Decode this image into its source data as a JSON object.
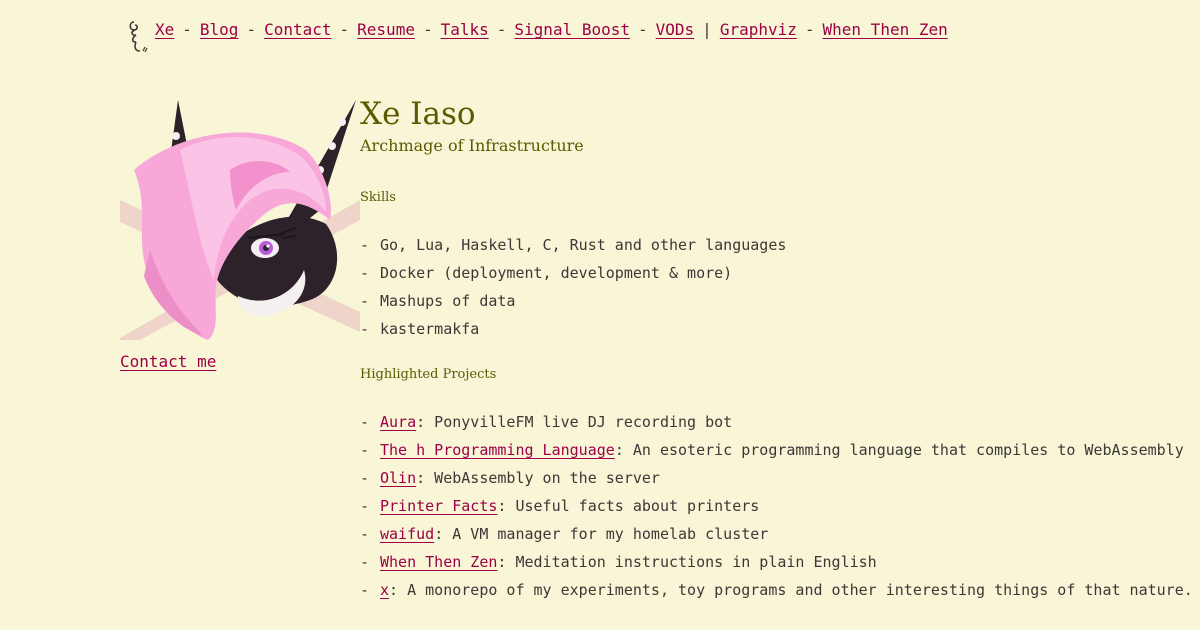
{
  "nav": {
    "links": [
      "Xe",
      "Blog",
      "Contact",
      "Resume",
      "Talks",
      "Signal Boost",
      "VODs"
    ],
    "extra_links": [
      "Graphviz",
      "When Then Zen"
    ],
    "separator": "-",
    "divider": "|"
  },
  "sidebar": {
    "contact_label": "Contact me"
  },
  "profile": {
    "name": "Xe Iaso",
    "tagline": "Archmage of Infrastructure"
  },
  "skills": {
    "heading": "Skills",
    "items": [
      "Go, Lua, Haskell, C, Rust and other languages",
      "Docker (deployment, development & more)",
      "Mashups of data",
      "kastermakfa"
    ]
  },
  "projects": {
    "heading": "Highlighted Projects",
    "items": [
      {
        "name": "Aura",
        "desc": ": PonyvilleFM live DJ recording bot"
      },
      {
        "name": "The h Programming Language",
        "desc": ": An esoteric programming language that compiles to WebAssembly"
      },
      {
        "name": "Olin",
        "desc": ": WebAssembly on the server"
      },
      {
        "name": "Printer Facts",
        "desc": ": Useful facts about printers"
      },
      {
        "name": "waifud",
        "desc": ": A VM manager for my homelab cluster"
      },
      {
        "name": "When Then Zen",
        "desc": ": Meditation instructions in plain English"
      },
      {
        "name": "x",
        "desc": ": A monorepo of my experiments, toy programs and other interesting things of that nature."
      }
    ]
  },
  "colors": {
    "background": "#f9f5d7",
    "link": "#9d0046",
    "heading": "#5b5a00",
    "text": "#3c3836"
  }
}
